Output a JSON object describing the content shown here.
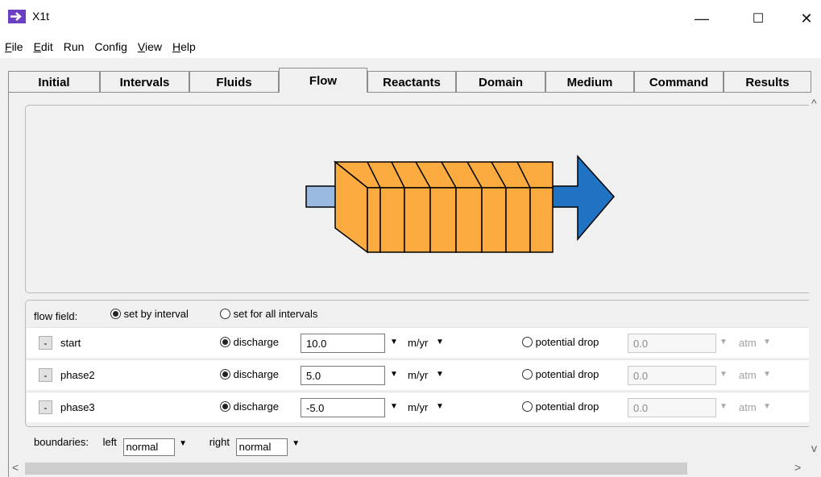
{
  "window": {
    "title": "X1t",
    "controls": {
      "minimize": "—",
      "maximize": "☐",
      "close": "✕"
    }
  },
  "menu": [
    {
      "label": "File",
      "underline": "F",
      "rest": "ile"
    },
    {
      "label": "Edit",
      "underline": "E",
      "rest": "dit"
    },
    {
      "label": "Run",
      "underline": "",
      "rest": "Run"
    },
    {
      "label": "Config",
      "underline": "",
      "rest": "Config"
    },
    {
      "label": "View",
      "underline": "V",
      "rest": "iew"
    },
    {
      "label": "Help",
      "underline": "H",
      "rest": "elp"
    }
  ],
  "tabs": [
    "Initial",
    "Intervals",
    "Fluids",
    "Flow",
    "Reactants",
    "Domain",
    "Medium",
    "Command",
    "Results"
  ],
  "active_tab": "Flow",
  "flow_field": {
    "label": "flow field:",
    "option_interval": "set by interval",
    "option_all": "set for all intervals",
    "selected": "set by interval"
  },
  "rows": [
    {
      "name": "start",
      "mode_label": "discharge",
      "discharge": "10.0",
      "unit": "m/yr",
      "alt_label": "potential drop",
      "drop": "0.0",
      "drop_unit": "atm"
    },
    {
      "name": "phase2",
      "mode_label": "discharge",
      "discharge": "5.0",
      "unit": "m/yr",
      "alt_label": "potential drop",
      "drop": "0.0",
      "drop_unit": "atm"
    },
    {
      "name": "phase3",
      "mode_label": "discharge",
      "discharge": "-5.0",
      "unit": "m/yr",
      "alt_label": "potential drop",
      "drop": "0.0",
      "drop_unit": "atm"
    }
  ],
  "row_button": "-",
  "boundaries": {
    "label": "boundaries:",
    "left_label": "left",
    "left_value": "normal",
    "right_label": "right",
    "right_value": "normal"
  },
  "colors": {
    "block_fill": "#fbab3f",
    "inlet_fill": "#9ab9e0",
    "outlet_fill": "#1f73c2",
    "app_icon": "#6a3fc4"
  },
  "icons": {
    "scroll_up": "^",
    "scroll_down": "v",
    "scroll_left": "<",
    "scroll_right": ">",
    "dropdown": "▼"
  }
}
